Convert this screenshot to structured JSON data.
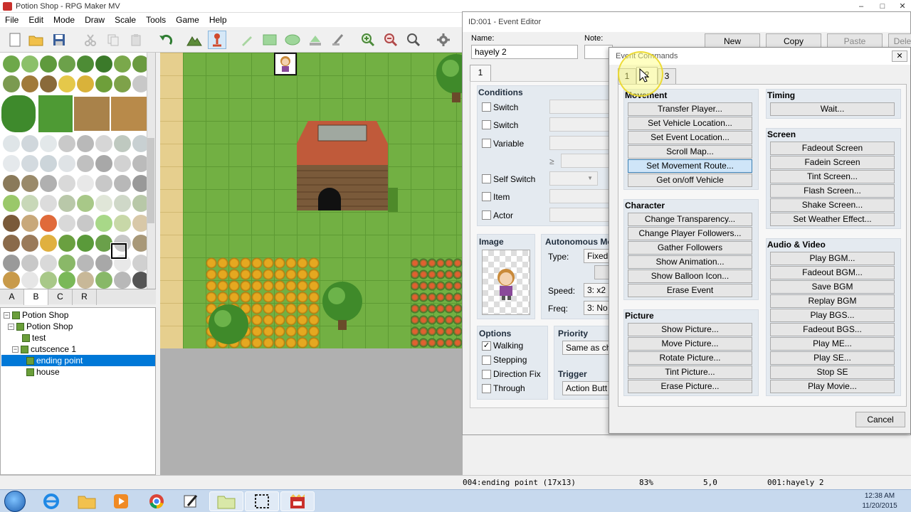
{
  "window": {
    "title": "Potion Shop - RPG Maker MV",
    "controls": [
      "–",
      "□",
      "✕"
    ]
  },
  "menu": [
    "File",
    "Edit",
    "Mode",
    "Draw",
    "Scale",
    "Tools",
    "Game",
    "Help"
  ],
  "toolbar": {
    "icons": [
      "new-project-icon",
      "open-folder-icon",
      "save-icon",
      "cut-icon",
      "copy-icon",
      "paste-icon",
      "undo-icon",
      "map-mode-icon",
      "event-mode-icon",
      "pencil-icon",
      "rectangle-icon",
      "ellipse-icon",
      "fill-icon",
      "shadow-pen-icon",
      "zoom-in-icon",
      "zoom-out-icon",
      "zoom-actual-icon",
      "database-icon"
    ]
  },
  "tileset_tabs": [
    "A",
    "B",
    "C",
    "R"
  ],
  "map_tree": [
    {
      "label": "Potion Shop",
      "level": 0,
      "fold": "−"
    },
    {
      "label": "Potion Shop",
      "level": 1,
      "fold": "−"
    },
    {
      "label": "test",
      "level": 2
    },
    {
      "label": "cutscence 1",
      "level": 2,
      "fold": "−"
    },
    {
      "label": "ending point",
      "level": 3,
      "selected": true
    },
    {
      "label": "house",
      "level": 3
    }
  ],
  "status": {
    "map": "004:ending point (17x13)",
    "zoom": "83%",
    "coords": "5,0",
    "event": "001:hayely 2"
  },
  "event_editor": {
    "title": "ID:001 - Event Editor",
    "name_label": "Name:",
    "name_value": "hayely 2",
    "note_label": "Note:",
    "buttons": {
      "new": "New",
      "copy": "Copy",
      "paste": "Paste",
      "delete": "Dele"
    },
    "page_tab": "1",
    "conditions": {
      "title": "Conditions",
      "items": [
        "Switch",
        "Switch",
        "Variable",
        "Self Switch",
        "Item",
        "Actor"
      ],
      "ge": "≥"
    },
    "image_label": "Image",
    "autonomous": {
      "title": "Autonomous Mo",
      "type_label": "Type:",
      "type_value": "Fixed",
      "speed_label": "Speed:",
      "speed_value": "3: x2",
      "freq_label": "Freq:",
      "freq_value": "3: No"
    },
    "options": {
      "title": "Options",
      "items": [
        {
          "label": "Walking",
          "checked": true
        },
        {
          "label": "Stepping",
          "checked": false
        },
        {
          "label": "Direction Fix",
          "checked": false
        },
        {
          "label": "Through",
          "checked": false
        }
      ]
    },
    "priority": {
      "title": "Priority",
      "value": "Same as cha"
    },
    "trigger": {
      "title": "Trigger",
      "value": "Action Butt"
    }
  },
  "event_commands": {
    "title": "Event Commands",
    "tabs": [
      "1",
      "2",
      "3"
    ],
    "cancel": "Cancel",
    "movement": {
      "title": "Movement",
      "items": [
        "Transfer Player...",
        "Set Vehicle Location...",
        "Set Event Location...",
        "Scroll Map...",
        "Set Movement Route...",
        "Get on/off Vehicle"
      ]
    },
    "character": {
      "title": "Character",
      "items": [
        "Change Transparency...",
        "Change Player Followers...",
        "Gather Followers",
        "Show Animation...",
        "Show Balloon Icon...",
        "Erase Event"
      ]
    },
    "picture": {
      "title": "Picture",
      "items": [
        "Show Picture...",
        "Move Picture...",
        "Rotate Picture...",
        "Tint Picture...",
        "Erase Picture..."
      ]
    },
    "timing": {
      "title": "Timing",
      "items": [
        "Wait..."
      ]
    },
    "screen": {
      "title": "Screen",
      "items": [
        "Fadeout Screen",
        "Fadein Screen",
        "Tint Screen...",
        "Flash Screen...",
        "Shake Screen...",
        "Set Weather Effect..."
      ]
    },
    "audio": {
      "title": "Audio & Video",
      "items": [
        "Play BGM...",
        "Fadeout BGM...",
        "Save BGM",
        "Replay BGM",
        "Play BGS...",
        "Fadeout BGS...",
        "Play ME...",
        "Play SE...",
        "Stop SE",
        "Play Movie..."
      ]
    }
  },
  "taskbar": {
    "time": "12:38 AM",
    "date": "11/20/2015"
  },
  "colors": {
    "grass": "#72b043",
    "selection": "#0078d7",
    "highlight": "#cfe5f8"
  }
}
